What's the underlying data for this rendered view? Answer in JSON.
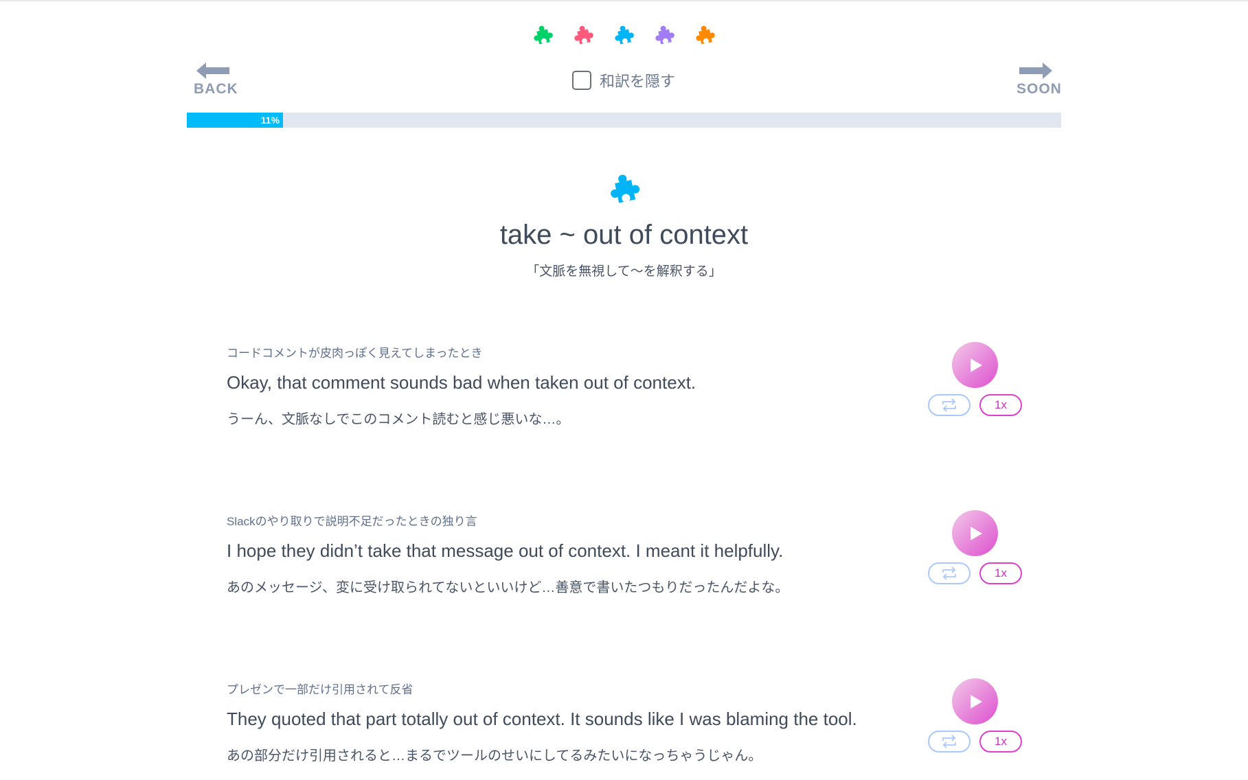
{
  "header": {
    "puzzle_colors": [
      "#00d26a",
      "#ff5a7e",
      "#00b4f5",
      "#a27cf5",
      "#ff8a00"
    ],
    "back_label": "BACK",
    "next_label": "SOON",
    "hide_translation_label": "和訳を隠す",
    "hide_translation_checked": false,
    "progress_percent": 11,
    "progress_label": "11%"
  },
  "phrase": {
    "icon_color": "#00b4f5",
    "title": "take ~ out of context",
    "meaning": "「文脈を無視して〜を解釈する」"
  },
  "examples": [
    {
      "context": "コードコメントが皮肉っぽく見えてしまったとき",
      "english": "Okay, that comment sounds bad when taken out of context.",
      "japanese": "うーん、文脈なしでこのコメント読むと感じ悪いな…。",
      "speed": "1x"
    },
    {
      "context": "Slackのやり取りで説明不足だったときの独り言",
      "english": "I hope they didn’t take that message out of context. I meant it helpfully.",
      "japanese": "あのメッセージ、変に受け取られてないといいけど…善意で書いたつもりだったんだよな。",
      "speed": "1x"
    },
    {
      "context": "プレゼンで一部だけ引用されて反省",
      "english": "They quoted that part totally out of context. It sounds like I was blaming the tool.",
      "japanese": "あの部分だけ引用されると…まるでツールのせいにしてるみたいになっちゃうじゃん。",
      "speed": "1x"
    }
  ]
}
